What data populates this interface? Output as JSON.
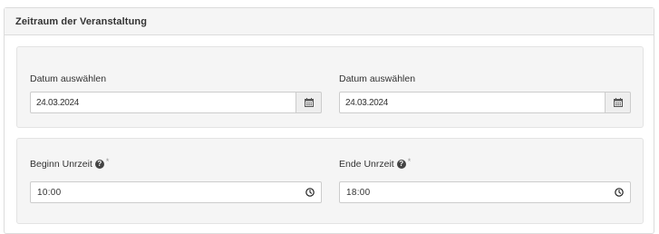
{
  "panel": {
    "title": "Zeitraum der Veranstaltung"
  },
  "dates": {
    "start": {
      "label": "Datum auswählen",
      "value": "24.03.2024",
      "icon": "calendar-icon"
    },
    "end": {
      "label": "Datum auswählen",
      "value": "24.03.2024",
      "icon": "calendar-icon"
    }
  },
  "times": {
    "start": {
      "label": "Beginn Unrzeit",
      "help_icon": "question-circle-icon",
      "required_marker": "*",
      "value": "10:00",
      "icon": "clock-icon"
    },
    "end": {
      "label": "Ende Unrzeit",
      "help_icon": "question-circle-icon",
      "required_marker": "*",
      "value": "18:00",
      "icon": "clock-icon"
    }
  },
  "colors": {
    "panel_heading_bg": "#f5f5f5",
    "well_bg": "#f5f5f5",
    "border": "#cccccc",
    "addon_bg": "#eeeeee",
    "text": "#333333"
  }
}
